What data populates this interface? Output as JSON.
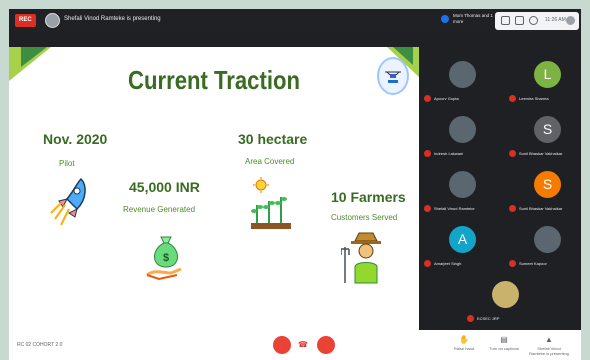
{
  "topbar": {
    "rec_label": "REC",
    "presenting_text": "Shefali Vinod Ramteke is presenting",
    "user_text": "Mom Thomas and 1 more",
    "clock": "11:26 AM"
  },
  "slide": {
    "title": "Current Traction",
    "pilot_date": "Nov. 2020",
    "pilot_label": "Pilot",
    "area_value": "30 hectare",
    "area_label": "Area Covered",
    "revenue_value": "45,000 INR",
    "revenue_label": "Revenue Generated",
    "farmers_value": "10 Farmers",
    "farmers_label": "Customers Served"
  },
  "participants": [
    {
      "name": "Apoorv Gupta",
      "initial": "",
      "color": "#5b6770"
    },
    {
      "name": "Leemira Sharma",
      "initial": "L",
      "color": "#7cb342"
    },
    {
      "name": "Indresh Lakwani",
      "initial": "",
      "color": "#5b6770"
    },
    {
      "name": "Sunil Bhaskar Vakhalkar",
      "initial": "S",
      "color": "#5f6368"
    },
    {
      "name": "Shefali Vinod Ramteke",
      "initial": "",
      "color": "#5b6770"
    },
    {
      "name": "Sunil Bhaskar Vakhalkar",
      "initial": "S",
      "color": "#f57c00"
    },
    {
      "name": "Amarjeet Singh",
      "initial": "A",
      "color": "#12a4c9"
    },
    {
      "name": "Sumeet Kapoor",
      "initial": "",
      "color": "#5b6770"
    },
    {
      "name": "ECSEC JRP",
      "initial": "",
      "color": "#c9b26b"
    }
  ],
  "bottombar": {
    "meeting_name": "RC 02 COHORT 2.0",
    "tools": [
      "Raise hand",
      "Turn on captions",
      "Shefali Vinod Ramteke is presenting"
    ]
  },
  "colors": {
    "accent_green": "#3a6b23",
    "record_red": "#d93025"
  }
}
